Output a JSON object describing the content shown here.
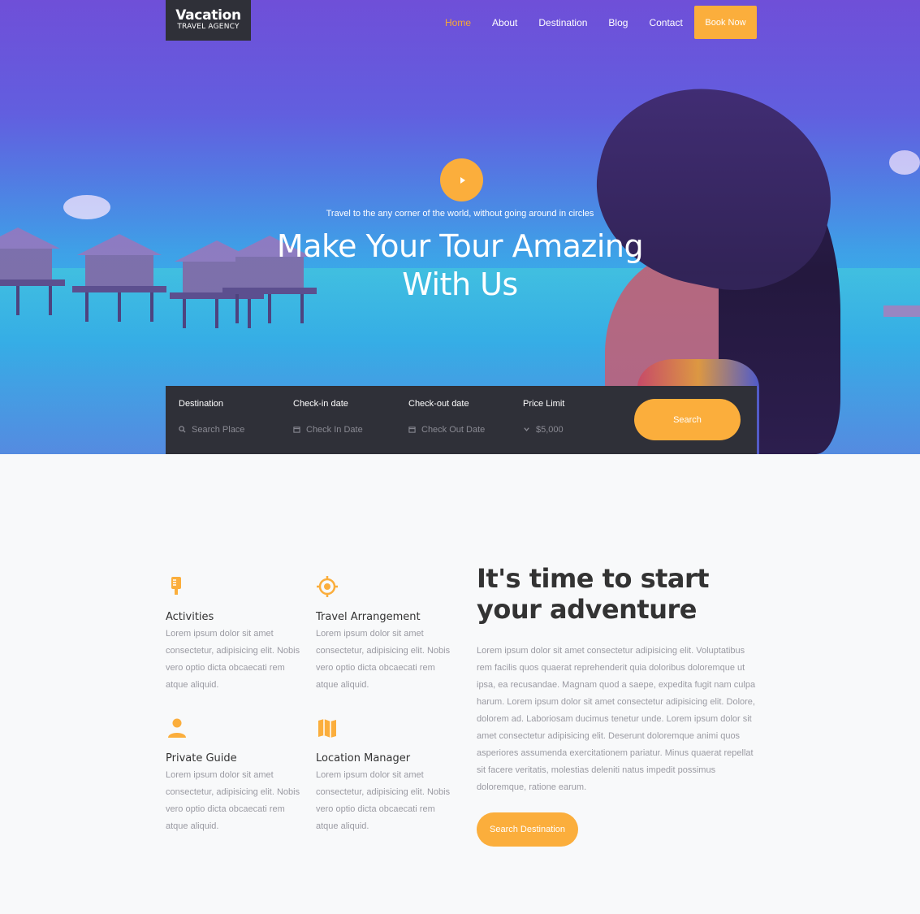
{
  "brand": {
    "name": "Vacation",
    "subtitle": "TRAVEL AGENCY"
  },
  "nav": {
    "items": [
      {
        "label": "Home",
        "active": true
      },
      {
        "label": "About",
        "active": false
      },
      {
        "label": "Destination",
        "active": false
      },
      {
        "label": "Blog",
        "active": false
      },
      {
        "label": "Contact",
        "active": false
      }
    ],
    "cta_label": "Book Now"
  },
  "hero": {
    "tagline": "Travel to the any corner of the world, without going around in circles",
    "headline_line1": "Make Your Tour Amazing",
    "headline_line2": "With Us",
    "play_icon": "play-icon"
  },
  "search": {
    "fields": [
      {
        "label": "Destination",
        "placeholder": "Search Place",
        "icon": "search-icon"
      },
      {
        "label": "Check-in date",
        "placeholder": "Check In Date",
        "icon": "calendar-icon"
      },
      {
        "label": "Check-out date",
        "placeholder": "Check Out Date",
        "icon": "calendar-icon"
      },
      {
        "label": "Price Limit",
        "value": "$5,000",
        "icon": "chevron-down-icon"
      }
    ],
    "button_label": "Search"
  },
  "features": [
    {
      "title": "Activities",
      "icon": "microphone-icon",
      "text": "Lorem ipsum dolor sit amet consectetur, adipisicing elit. Nobis vero optio dicta obcaecati rem atque aliquid."
    },
    {
      "title": "Travel Arrangement",
      "icon": "location-target-icon",
      "text": "Lorem ipsum dolor sit amet consectetur, adipisicing elit. Nobis vero optio dicta obcaecati rem atque aliquid."
    },
    {
      "title": "Private Guide",
      "icon": "person-icon",
      "text": "Lorem ipsum dolor sit amet consectetur, adipisicing elit. Nobis vero optio dicta obcaecati rem atque aliquid."
    },
    {
      "title": "Location Manager",
      "icon": "map-icon",
      "text": "Lorem ipsum dolor sit amet consectetur, adipisicing elit. Nobis vero optio dicta obcaecati rem atque aliquid."
    }
  ],
  "intro": {
    "heading": "It's time to start your adventure",
    "body": "Lorem ipsum dolor sit amet consectetur adipisicing elit. Voluptatibus rem facilis quos quaerat reprehenderit quia doloribus doloremque ut ipsa, ea recusandae. Magnam quod a saepe, expedita fugit nam culpa harum. Lorem ipsum dolor sit amet consectetur adipisicing elit. Dolore, dolorem ad. Laboriosam ducimus tenetur unde. Lorem ipsum dolor sit amet consectetur adipisicing elit. Deserunt doloremque animi quos asperiores assumenda exercitationem pariatur. Minus quaerat repellat sit facere veritatis, molestias deleniti natus impedit possimus doloremque, ratione earum.",
    "button_label": "Search Destination"
  },
  "colors": {
    "accent": "#fbae3c",
    "dark": "#2f3038",
    "muted_text": "#9a9aa2"
  }
}
